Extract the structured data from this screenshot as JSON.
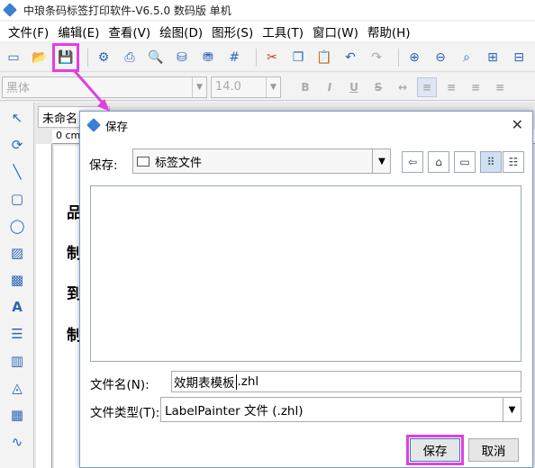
{
  "app": {
    "title": "中琅条码标签打印软件-V6.5.0 数码版 单机"
  },
  "menu": [
    "文件(F)",
    "编辑(E)",
    "查看(V)",
    "绘图(D)",
    "图形(S)",
    "工具(T)",
    "窗口(W)",
    "帮助(H)"
  ],
  "format": {
    "font": "黑体",
    "size": "14.0"
  },
  "document": {
    "tab": "未命名",
    "ruler": "0 cm",
    "canvas_chars": [
      "品",
      "制",
      "到",
      "制"
    ]
  },
  "dialog": {
    "title": "保存",
    "lookin_label": "保存:",
    "lookin_value": "标签文件",
    "filename_label": "文件名(N):",
    "filename_value_before": "效期表模板",
    "filename_value_after": ".zhl",
    "filetype_label": "文件类型(T):",
    "filetype_value": "LabelPainter 文件 (.zhl)",
    "save_button": "保存",
    "cancel_button": "取消"
  },
  "colors": {
    "highlight": "#e040e0",
    "accent": "#2a66b8"
  }
}
